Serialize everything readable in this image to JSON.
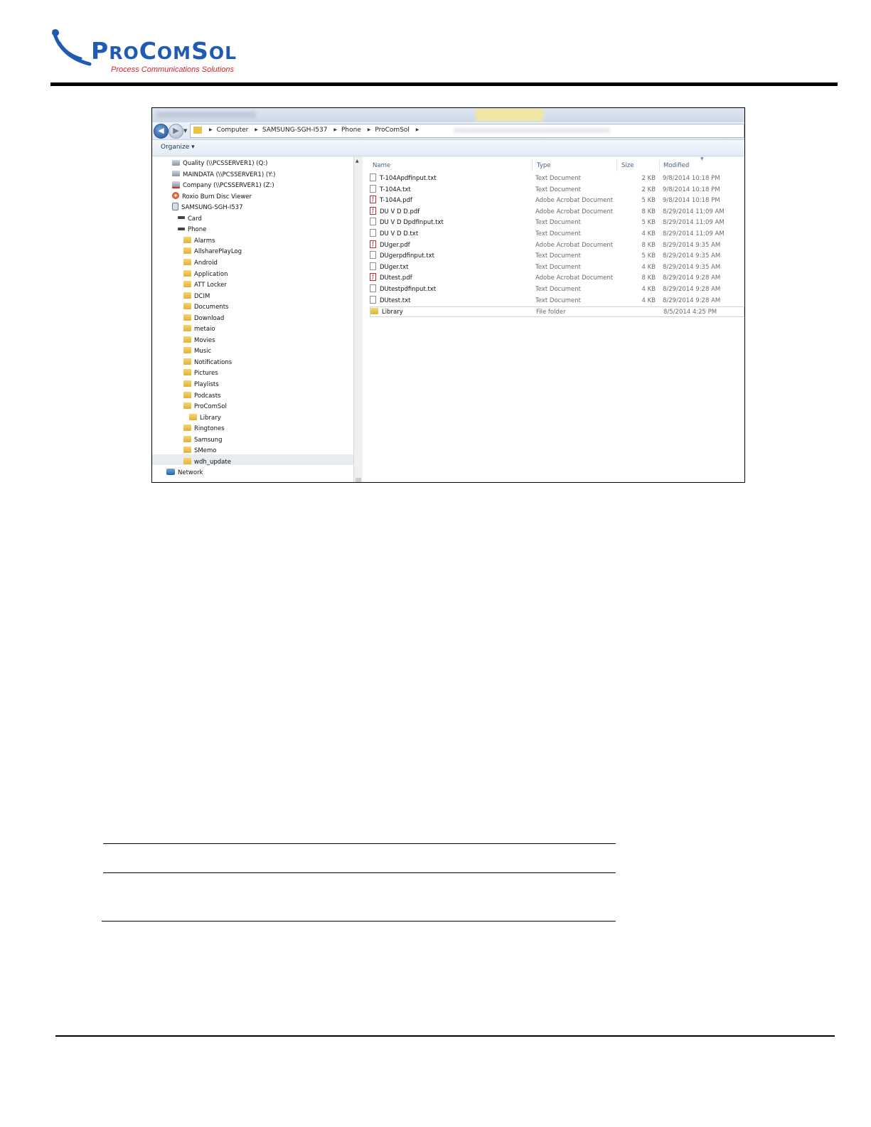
{
  "logo": {
    "brand": "ProComSol",
    "tagline": "Process Communications Solutions",
    "brand_color": "#1f5bb4",
    "tagline_color": "#d6232a"
  },
  "explorer": {
    "breadcrumb": [
      "Computer",
      "SAMSUNG-SGH-I537",
      "Phone",
      "ProComSol"
    ],
    "toolbar": {
      "organize_label": "Organize ▾"
    },
    "nav_items": [
      {
        "label": "Quality (\\\\PCSSERVER1) (Q:)",
        "icon": "network-drive-icon"
      },
      {
        "label": "MAINDATA (\\\\PCSSERVER1) (Y:)",
        "icon": "network-drive-icon"
      },
      {
        "label": "Company (\\\\PCSSERVER1) (Z:)",
        "icon": "disconnected-drive-icon"
      },
      {
        "label": "Roxio Burn Disc Viewer",
        "icon": "disc-icon"
      },
      {
        "label": "SAMSUNG-SGH-I537",
        "icon": "phone-icon"
      },
      {
        "label": "Card",
        "icon": "card-icon"
      },
      {
        "label": "Phone",
        "icon": "card-icon"
      },
      {
        "label": "Alarms",
        "icon": "folder-icon"
      },
      {
        "label": "AllsharePlayLog",
        "icon": "folder-icon"
      },
      {
        "label": "Android",
        "icon": "folder-icon"
      },
      {
        "label": "Application",
        "icon": "folder-icon"
      },
      {
        "label": "ATT Locker",
        "icon": "folder-icon"
      },
      {
        "label": "DCIM",
        "icon": "folder-icon"
      },
      {
        "label": "Documents",
        "icon": "folder-icon"
      },
      {
        "label": "Download",
        "icon": "folder-icon"
      },
      {
        "label": "metaio",
        "icon": "folder-icon"
      },
      {
        "label": "Movies",
        "icon": "folder-icon"
      },
      {
        "label": "Music",
        "icon": "folder-icon"
      },
      {
        "label": "Notifications",
        "icon": "folder-icon"
      },
      {
        "label": "Pictures",
        "icon": "folder-icon"
      },
      {
        "label": "Playlists",
        "icon": "folder-icon"
      },
      {
        "label": "Podcasts",
        "icon": "folder-icon"
      },
      {
        "label": "ProComSol",
        "icon": "folder-icon",
        "selected": true
      },
      {
        "label": "Library",
        "icon": "folder-icon"
      },
      {
        "label": "Ringtones",
        "icon": "folder-icon"
      },
      {
        "label": "Samsung",
        "icon": "folder-icon"
      },
      {
        "label": "SMemo",
        "icon": "folder-icon"
      },
      {
        "label": "wdh_update",
        "icon": "folder-icon"
      },
      {
        "label": "Network",
        "icon": "network-icon"
      }
    ],
    "columns": {
      "name": "Name",
      "type": "Type",
      "size": "Size",
      "modified": "Modified"
    },
    "files": [
      {
        "name": "T-104Apdfinput.txt",
        "type": "Text Document",
        "size": "2 KB",
        "modified": "9/8/2014 10:18 PM",
        "icon": "txt"
      },
      {
        "name": "T-104A.txt",
        "type": "Text Document",
        "size": "2 KB",
        "modified": "9/8/2014 10:18 PM",
        "icon": "txt"
      },
      {
        "name": "T-104A.pdf",
        "type": "Adobe Acrobat Document",
        "size": "5 KB",
        "modified": "9/8/2014 10:18 PM",
        "icon": "pdf"
      },
      {
        "name": "DU V D D.pdf",
        "type": "Adobe Acrobat Document",
        "size": "8 KB",
        "modified": "8/29/2014 11:09 AM",
        "icon": "pdf"
      },
      {
        "name": "DU V D Dpdfinput.txt",
        "type": "Text Document",
        "size": "5 KB",
        "modified": "8/29/2014 11:09 AM",
        "icon": "txt"
      },
      {
        "name": "DU V D D.txt",
        "type": "Text Document",
        "size": "4 KB",
        "modified": "8/29/2014 11:09 AM",
        "icon": "txt"
      },
      {
        "name": "DUger.pdf",
        "type": "Adobe Acrobat Document",
        "size": "8 KB",
        "modified": "8/29/2014 9:35 AM",
        "icon": "pdf"
      },
      {
        "name": "DUgerpdfinput.txt",
        "type": "Text Document",
        "size": "5 KB",
        "modified": "8/29/2014 9:35 AM",
        "icon": "txt"
      },
      {
        "name": "DUger.txt",
        "type": "Text Document",
        "size": "4 KB",
        "modified": "8/29/2014 9:35 AM",
        "icon": "txt"
      },
      {
        "name": "DUtest.pdf",
        "type": "Adobe Acrobat Document",
        "size": "8 KB",
        "modified": "8/29/2014 9:28 AM",
        "icon": "pdf"
      },
      {
        "name": "DUtestpdfinput.txt",
        "type": "Text Document",
        "size": "4 KB",
        "modified": "8/29/2014 9:28 AM",
        "icon": "txt"
      },
      {
        "name": "DUtest.txt",
        "type": "Text Document",
        "size": "4 KB",
        "modified": "8/29/2014 9:28 AM",
        "icon": "txt"
      },
      {
        "name": "Library",
        "type": "File folder",
        "size": "",
        "modified": "8/5/2014 4:25 PM",
        "icon": "folder"
      }
    ]
  }
}
